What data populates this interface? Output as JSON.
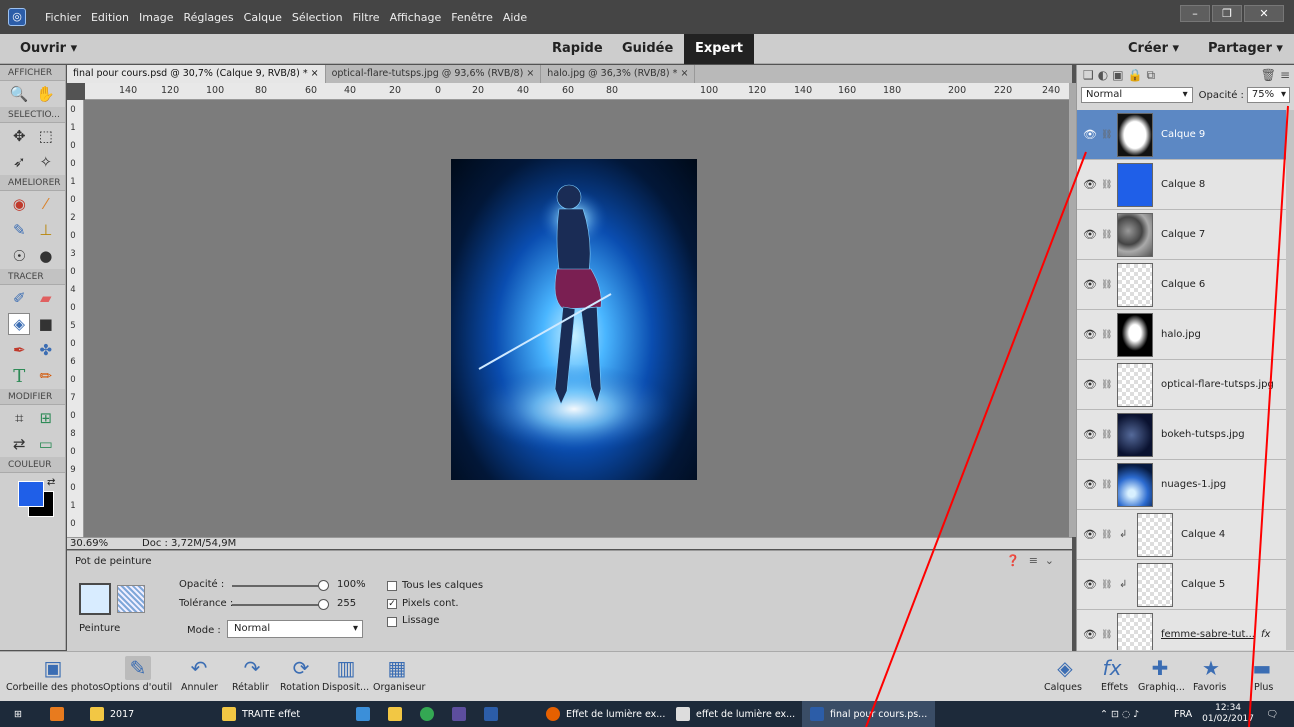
{
  "menubar": {
    "items": [
      "Fichier",
      "Edition",
      "Image",
      "Réglages",
      "Calque",
      "Sélection",
      "Filtre",
      "Affichage",
      "Fenêtre",
      "Aide"
    ]
  },
  "modebar": {
    "open_label": "Ouvrir",
    "modes": [
      "Rapide",
      "Guidée",
      "Expert"
    ],
    "create_label": "Créer",
    "share_label": "Partager"
  },
  "toolbox": {
    "sections": [
      "AFFICHER",
      "SELECTIO...",
      "AMELIORER",
      "TRACER",
      "MODIFIER",
      "COULEUR"
    ]
  },
  "tabs": [
    "final pour cours.psd @ 30,7% (Calque 9, RVB/8) *",
    "optical-flare-tutsps.jpg @ 93,6% (RVB/8)",
    "halo.jpg @ 36,3% (RVB/8) *"
  ],
  "ruler": {
    "marks": [
      "140",
      "120",
      "100",
      "80",
      "60",
      "40",
      "20",
      "0",
      "20",
      "40",
      "60",
      "80",
      "100",
      "120",
      "140",
      "160",
      "180",
      "200",
      "220",
      "240"
    ]
  },
  "status": {
    "zoom": "30.69%",
    "doc": "Doc : 3,72M/54,9M"
  },
  "tool_options": {
    "title": "Pot de peinture",
    "mode_label": "Peinture",
    "opacity_label": "Opacité :",
    "opacity_value": "100%",
    "tolerance_label": "Tolérance :",
    "tolerance_value": "255",
    "mode_field_label": "Mode :",
    "mode_value": "Normal",
    "checkboxes": [
      {
        "label": "Tous les calques",
        "checked": false
      },
      {
        "label": "Pixels cont.",
        "checked": true
      },
      {
        "label": "Lissage",
        "checked": false
      }
    ]
  },
  "layers_panel": {
    "blend_mode": "Normal",
    "opacity_label": "Opacité :",
    "opacity_value": "75%",
    "layers": [
      {
        "name": "Calque 9",
        "selected": true
      },
      {
        "name": "Calque 8"
      },
      {
        "name": "Calque 7"
      },
      {
        "name": "Calque 6"
      },
      {
        "name": "halo.jpg"
      },
      {
        "name": "optical-flare-tutsps.jpg"
      },
      {
        "name": "bokeh-tutsps.jpg"
      },
      {
        "name": "nuages-1.jpg"
      },
      {
        "name": "Calque 4"
      },
      {
        "name": "Calque 5"
      },
      {
        "name": "femme-sabre-tut..."
      }
    ]
  },
  "bottombar": {
    "left": [
      "Corbeille des photos",
      "Options d'outil",
      "Annuler",
      "Rétablir",
      "Rotation",
      "Disposit...",
      "Organiseur"
    ],
    "right": [
      "Calques",
      "Effets",
      "Graphiq...",
      "Favoris",
      "Plus"
    ]
  },
  "taskbar": {
    "items": [
      "2017",
      "TRAITE effet",
      "Effet de lumière ex...",
      "effet de lumière ex...",
      "final pour cours.ps..."
    ],
    "lang": "FRA",
    "time": "12:34",
    "date": "01/02/2017"
  },
  "colors": {
    "accent": "#5c88c4",
    "foreground_swatch": "#1f5fe8",
    "annotation_line": "#ff0000"
  }
}
